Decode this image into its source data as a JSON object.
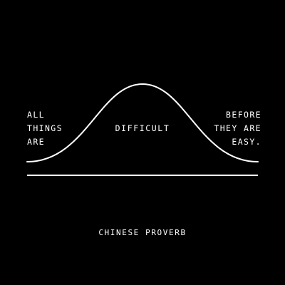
{
  "colors": {
    "background": "#000000",
    "foreground": "#ffffff"
  },
  "diagram": {
    "left_text": [
      "ALL",
      "THINGS",
      "ARE"
    ],
    "center_text": "DIFFICULT",
    "right_text": [
      "BEFORE",
      "THEY ARE",
      "EASY."
    ]
  },
  "attribution": "CHINESE PROVERB"
}
